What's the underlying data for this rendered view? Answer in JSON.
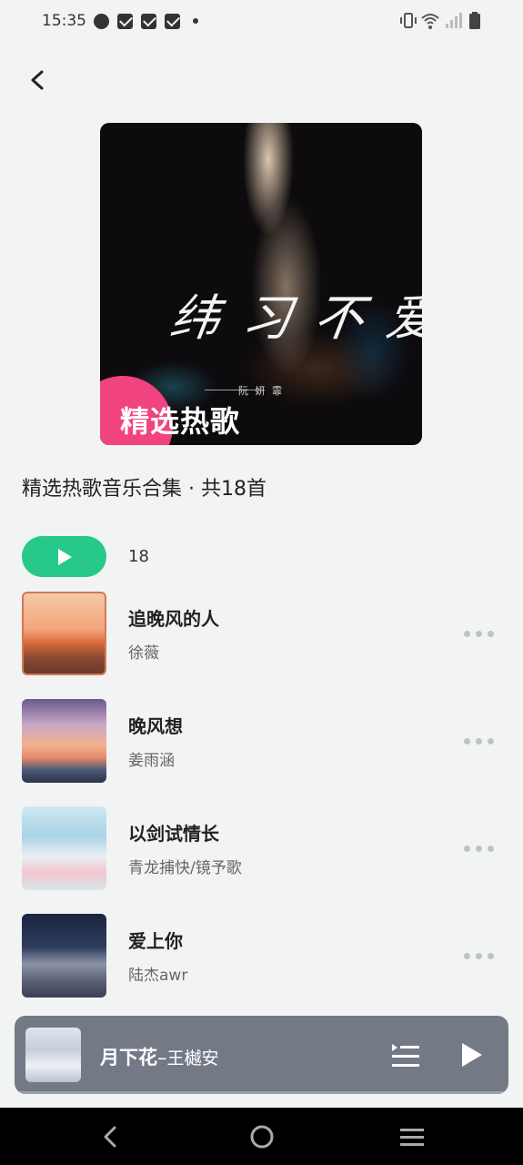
{
  "status_bar": {
    "time": "15:35",
    "left_icons": [
      "speedometer-icon",
      "mail-icon",
      "mail-icon",
      "mail-icon",
      "dot-icon"
    ],
    "right_icons": [
      "vibrate-icon",
      "wifi-icon",
      "signal-icon",
      "battery-icon"
    ]
  },
  "cover": {
    "script_title": "纬 习 不 爱 你",
    "artist_text": "阮 妍 霏",
    "badge": "精选热歌",
    "accent": "#f0437f"
  },
  "playlist": {
    "title": "精选热歌音乐合集 · 共18首",
    "count": "18"
  },
  "songs": [
    {
      "title": "追晚风的人",
      "artist": "徐薇"
    },
    {
      "title": "晚风想",
      "artist": "姜雨涵"
    },
    {
      "title": "以剑试情长",
      "artist": "青龙捕快/镜予歌"
    },
    {
      "title": "爱上你",
      "artist": "陆杰awr"
    }
  ],
  "mini_player": {
    "title": "月下花",
    "separator": "–",
    "artist": "王樾安"
  },
  "colors": {
    "accent_green": "#27c98b",
    "background": "#f2f4f4",
    "mini_player_bg": "#737a86"
  }
}
